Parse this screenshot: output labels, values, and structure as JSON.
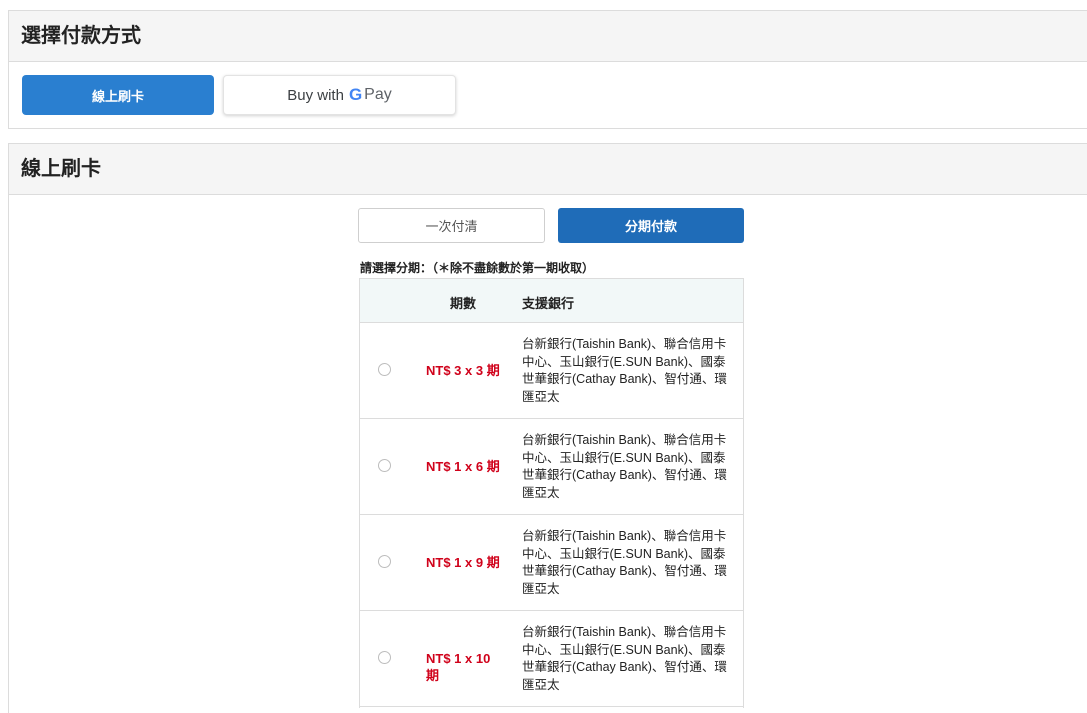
{
  "payment_method": {
    "title": "選擇付款方式",
    "card_button": "線上刷卡",
    "gpay": {
      "prefix": "Buy with",
      "g": "G",
      "pay": "Pay"
    }
  },
  "card_section": {
    "title": "線上刷卡",
    "tab_once": "一次付清",
    "tab_installment": "分期付款",
    "instruction": "請選擇分期：（＊除不盡餘數於第一期收取）",
    "table": {
      "header_period": "期數",
      "header_bank": "支援銀行",
      "rows": [
        {
          "amount": "NT$ 3 x 3 期",
          "banks": "台新銀行(Taishin Bank)、聯合信用卡中心、玉山銀行(E.SUN Bank)、國泰世華銀行(Cathay Bank)、智付通、環匯亞太"
        },
        {
          "amount": "NT$ 1 x 6 期",
          "banks": "台新銀行(Taishin Bank)、聯合信用卡中心、玉山銀行(E.SUN Bank)、國泰世華銀行(Cathay Bank)、智付通、環匯亞太"
        },
        {
          "amount": "NT$ 1 x 9 期",
          "banks": "台新銀行(Taishin Bank)、聯合信用卡中心、玉山銀行(E.SUN Bank)、國泰世華銀行(Cathay Bank)、智付通、環匯亞太"
        },
        {
          "amount": "NT$ 1 x 10 期",
          "banks": "台新銀行(Taishin Bank)、聯合信用卡中心、玉山銀行(E.SUN Bank)、國泰世華銀行(Cathay Bank)、智付通、環匯亞太"
        }
      ]
    }
  },
  "colors": {
    "primary_blue": "#2a7fd0",
    "dark_blue": "#1f6cb8",
    "amount_red": "#d0021b",
    "google_blue": "#4285F4",
    "google_red": "#EA4335"
  }
}
